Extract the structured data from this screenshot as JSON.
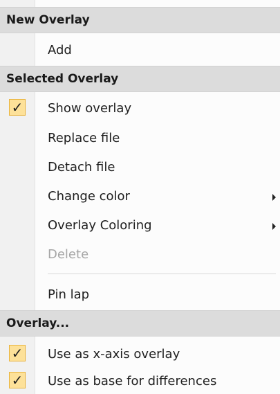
{
  "menu": {
    "new_overlay": {
      "header": "New Overlay",
      "items": [
        {
          "label": "Add"
        }
      ]
    },
    "selected_overlay": {
      "header": "Selected Overlay",
      "items": [
        {
          "label": "Show overlay",
          "checked": true,
          "check_icon": "checkmark-icon"
        },
        {
          "label": "Replace file"
        },
        {
          "label": "Detach file"
        },
        {
          "label": "Change color",
          "submenu": true
        },
        {
          "label": "Overlay Coloring",
          "submenu": true
        },
        {
          "label": "Delete",
          "enabled": false
        },
        {
          "label": "Pin lap"
        }
      ]
    },
    "overlay_options": {
      "header": "Overlay...",
      "items": [
        {
          "label": "Use as x-axis overlay",
          "checked": true,
          "check_icon": "checkmark-icon"
        },
        {
          "label": "Use as base for differences",
          "checked": true,
          "check_icon": "checkmark-icon"
        }
      ]
    },
    "check_glyph": "✓",
    "colors": {
      "header_bg": "#dcdcdc",
      "check_bg": "#fde199",
      "check_border": "#e9b43e",
      "disabled_text": "#a6a6a6"
    }
  }
}
